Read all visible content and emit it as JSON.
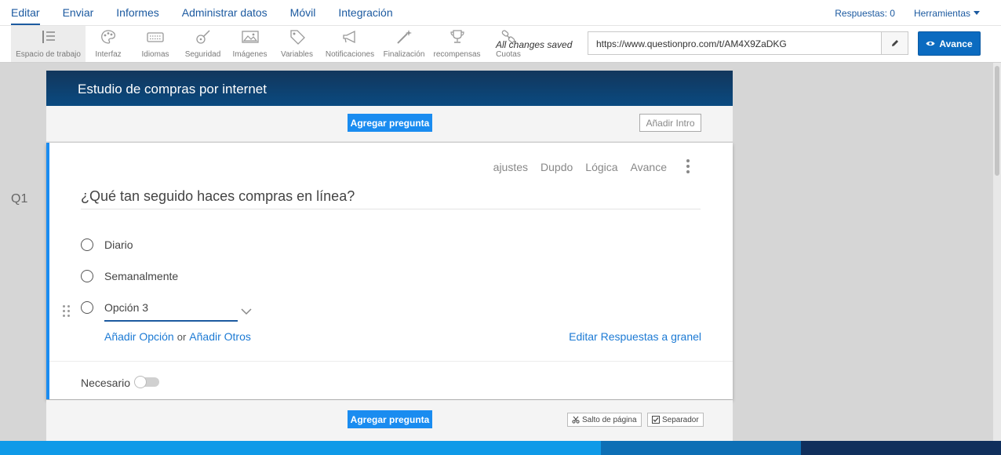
{
  "nav": {
    "items": [
      "Editar",
      "Enviar",
      "Informes",
      "Administrar datos",
      "Móvil",
      "Integración"
    ],
    "responses": "Respuestas: 0",
    "tools": "Herramientas"
  },
  "toolbar": {
    "tools": [
      {
        "label": "Espacio de trabajo",
        "icon": "workspace-icon"
      },
      {
        "label": "Interfaz",
        "icon": "palette-icon"
      },
      {
        "label": "Idiomas",
        "icon": "keyboard-icon"
      },
      {
        "label": "Seguridad",
        "icon": "guitar-icon"
      },
      {
        "label": "Imágenes",
        "icon": "image-icon"
      },
      {
        "label": "Variables",
        "icon": "tag-icon"
      },
      {
        "label": "Notificaciones",
        "icon": "megaphone-icon"
      },
      {
        "label": "Finalización",
        "icon": "wand-icon"
      },
      {
        "label": "recompensas",
        "icon": "trophy-icon"
      },
      {
        "label": "Cuotas",
        "icon": "link-icon"
      }
    ],
    "saved": "All changes saved",
    "url": "https://www.questionpro.com/t/AM4X9ZaDKG",
    "preview": "Avance"
  },
  "survey": {
    "title": "Estudio de compras por internet",
    "add_question": "Agregar pregunta",
    "add_intro": "Añadir Intro",
    "question_number": "Q1",
    "actions": [
      "ajustes",
      "Dupdo",
      "Lógica",
      "Avance"
    ],
    "question": "¿Qué tan seguido haces compras en línea?",
    "options": [
      "Diario",
      "Semanalmente",
      "Opción 3"
    ],
    "add_option": "Añadir Opción",
    "or": "or",
    "add_other": "Añadir Otros",
    "bulk_edit": "Editar Respuestas a granel",
    "required": "Necesario",
    "page_break": "Salto de página",
    "separator": "Separador"
  },
  "colors": {
    "accent": "#1a8cf0",
    "nav_text": "#1c5aa0",
    "header_dark": "#0a4a80",
    "footer": [
      "#0f9ae8",
      "#0d6fb5",
      "#102f5c"
    ]
  }
}
